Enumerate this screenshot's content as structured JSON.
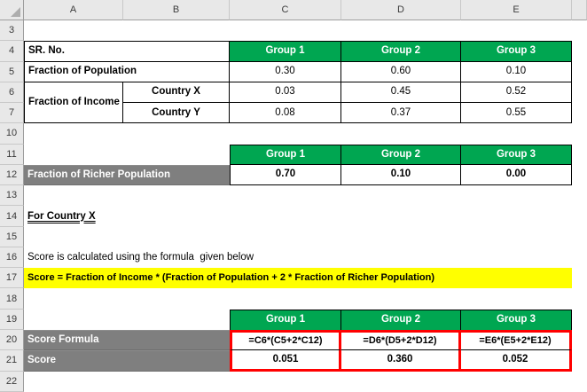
{
  "sheet": {
    "columns": [
      "A",
      "B",
      "C",
      "D",
      "E"
    ],
    "rows": [
      "3",
      "4",
      "5",
      "6",
      "7",
      "10",
      "11",
      "12",
      "13",
      "14",
      "15",
      "16",
      "17",
      "18",
      "19",
      "20",
      "21",
      "22"
    ]
  },
  "groups": [
    "Group 1",
    "Group 2",
    "Group 3"
  ],
  "table1": {
    "sr_label": "SR. No.",
    "pop_label": "Fraction of Population",
    "pop_values": [
      "0.30",
      "0.60",
      "0.10"
    ],
    "income_label": "Fraction of Income",
    "country_x": "Country X",
    "country_y": "Country Y",
    "income_x_values": [
      "0.03",
      "0.45",
      "0.52"
    ],
    "income_y_values": [
      "0.08",
      "0.37",
      "0.55"
    ]
  },
  "table2": {
    "label": "Fraction of Richer Population",
    "values": [
      "0.70",
      "0.10",
      "0.00"
    ]
  },
  "notes": {
    "heading": "For Country X",
    "description": "Score is calculated using the formula  given below",
    "formula_highlight": "Score = Fraction of Income * (Fraction of Population + 2 * Fraction of Richer Population)"
  },
  "table3": {
    "formula_label": "Score Formula",
    "formulas": [
      "=C6*(C5+2*C12)",
      "=D6*(D5+2*D12)",
      "=E6*(E5+2*E12)"
    ],
    "score_label": "Score",
    "scores": [
      "0.051",
      "0.360",
      "0.052"
    ]
  },
  "colors": {
    "header_green": "#00A651",
    "label_gray": "#7F7F7F",
    "highlight_yellow": "#FFFF00",
    "callout_red": "#FF0000"
  }
}
